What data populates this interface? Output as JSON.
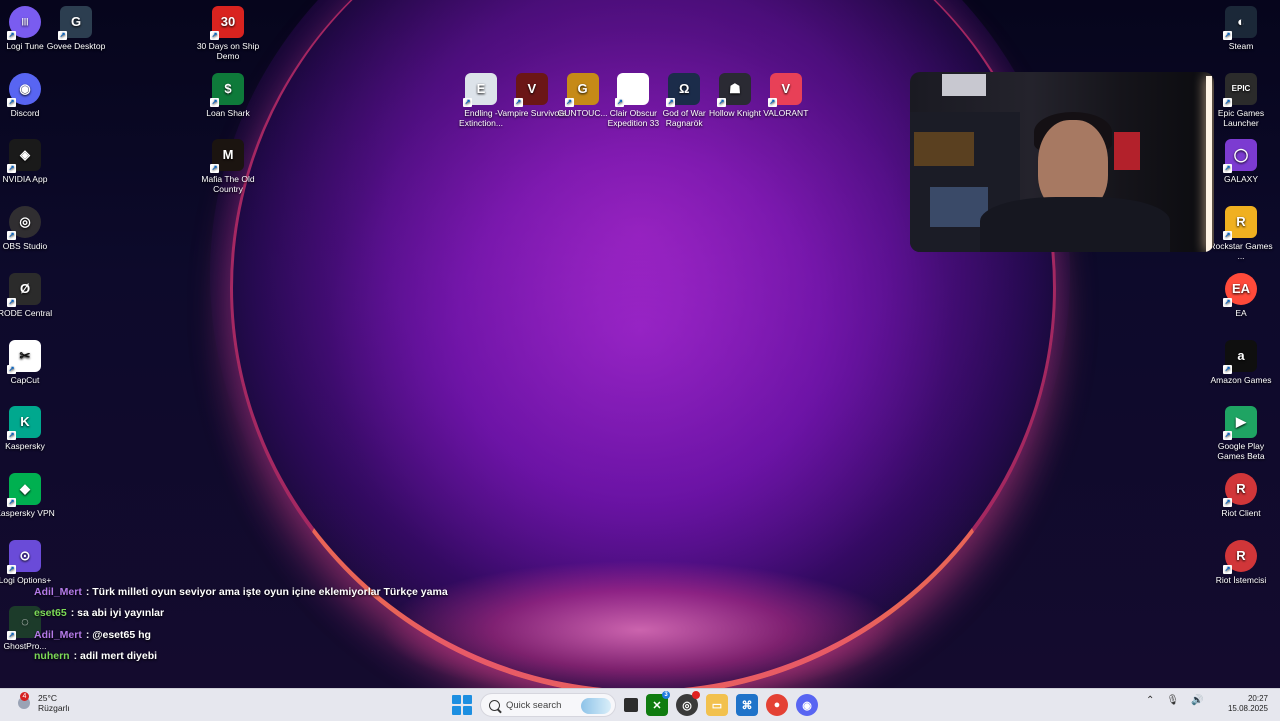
{
  "desktop": {
    "left_column": [
      {
        "label": "Logi Tune",
        "name": "logi-tune-icon",
        "color": "#7a5cf0",
        "glyph": "|||",
        "round": true
      },
      {
        "label": "Discord",
        "name": "discord-icon",
        "color": "#5865f2",
        "glyph": "◉",
        "round": true
      },
      {
        "label": "NVIDIA App",
        "name": "nvidia-app-icon",
        "color": "#1a1a1a",
        "glyph": "◈",
        "round": false
      },
      {
        "label": "OBS Studio",
        "name": "obs-studio-icon",
        "color": "#302e31",
        "glyph": "◎",
        "round": true
      },
      {
        "label": "RODE Central",
        "name": "rode-central-icon",
        "color": "#2b2b2b",
        "glyph": "Ø",
        "round": false
      },
      {
        "label": "CapCut",
        "name": "capcut-icon",
        "color": "#ffffff",
        "glyph": "✂",
        "round": false
      },
      {
        "label": "Kaspersky",
        "name": "kaspersky-icon",
        "color": "#00a88e",
        "glyph": "K",
        "round": false
      },
      {
        "label": "Kaspersky VPN",
        "name": "kaspersky-vpn-icon",
        "color": "#00b050",
        "glyph": "◆",
        "round": false
      },
      {
        "label": "Logi Options+",
        "name": "logi-options-icon",
        "color": "#6a4bd8",
        "glyph": "⊙",
        "round": false
      },
      {
        "label": "GhostPro...",
        "name": "ghostpro-icon",
        "color": "#1c3b2a",
        "glyph": "◌",
        "round": false
      }
    ],
    "second_column": [
      {
        "label": "Govee Desktop",
        "name": "govee-desktop-icon",
        "color": "#2c3e50",
        "glyph": "G"
      }
    ],
    "third_column": [
      {
        "label": "30 Days on Ship Demo",
        "name": "30-days-on-ship-icon",
        "color": "#d9231f",
        "glyph": "30"
      },
      {
        "label": "Loan Shark",
        "name": "loan-shark-icon",
        "color": "#0e7a3a",
        "glyph": "$"
      },
      {
        "label": "Mafia The Old Country",
        "name": "mafia-old-country-icon",
        "color": "#1b1410",
        "glyph": "M"
      }
    ],
    "games_row": [
      {
        "label": "Endling - Extinction...",
        "name": "endling-icon",
        "color": "#dde3ea",
        "glyph": "E"
      },
      {
        "label": "Vampire Survivors",
        "name": "vampire-survivors-icon",
        "color": "#6b1616",
        "glyph": "V"
      },
      {
        "label": "GUNTOUC...",
        "name": "guntouchables-icon",
        "color": "#c68a17",
        "glyph": "G"
      },
      {
        "label": "Clair Obscur Expedition 33",
        "name": "clair-obscur-icon",
        "color": "#ffffff",
        "glyph": ""
      },
      {
        "label": "God of War Ragnarök",
        "name": "god-of-war-icon",
        "color": "#1b2c4a",
        "glyph": "Ω"
      },
      {
        "label": "Hollow Knight",
        "name": "hollow-knight-icon",
        "color": "#2a2a33",
        "glyph": "☗"
      },
      {
        "label": "VALORANT",
        "name": "valorant-icon",
        "color": "#e84057",
        "glyph": "V"
      }
    ],
    "right_column": [
      {
        "label": "Steam",
        "name": "steam-icon",
        "color": "#1b2838",
        "glyph": "◐"
      },
      {
        "label": "Epic Games Launcher",
        "name": "epic-games-icon",
        "color": "#2b2b2b",
        "glyph": "EPIC"
      },
      {
        "label": "GALAXY",
        "name": "gog-galaxy-icon",
        "color": "#7c3bd1",
        "glyph": "◯"
      },
      {
        "label": "Rockstar Games ...",
        "name": "rockstar-icon",
        "color": "#f0b020",
        "glyph": "R"
      },
      {
        "label": "EA",
        "name": "ea-icon",
        "color": "#ff4a3a",
        "glyph": "EA"
      },
      {
        "label": "Amazon Games",
        "name": "amazon-games-icon",
        "color": "#0f0f0f",
        "glyph": "a"
      },
      {
        "label": "Google Play Games Beta",
        "name": "google-play-games-icon",
        "color": "#1fa463",
        "glyph": "▶"
      },
      {
        "label": "Riot Client",
        "name": "riot-client-icon",
        "color": "#d13639",
        "glyph": "R"
      },
      {
        "label": "Riot İstemcisi",
        "name": "riot-istemcisi-icon",
        "color": "#d13639",
        "glyph": "R"
      }
    ]
  },
  "chat": [
    {
      "user": "Adil_Mert",
      "user_color": "#b47ae8",
      "text": ": Türk milleti oyun seviyor ama işte oyun içine eklemiyorlar Türkçe yama"
    },
    {
      "user": "eset65",
      "user_color": "#7cd957",
      "text": ": sa abi iyi yayınlar"
    },
    {
      "user": "Adil_Mert",
      "user_color": "#b47ae8",
      "text": ": @eset65 hg"
    },
    {
      "user": "nuhern",
      "user_color": "#7cd957",
      "text": ": adil mert diyebi"
    }
  ],
  "taskbar": {
    "weather_temp": "25°C",
    "weather_location": "Rüzgarlı",
    "weather_badge": "4",
    "search_placeholder": "Quick search",
    "xbox_badge": "3",
    "time": "20:27",
    "date": "15.08.2025",
    "tray_icons": [
      "chevron-up-icon",
      "microphone-icon",
      "speaker-icon"
    ]
  }
}
